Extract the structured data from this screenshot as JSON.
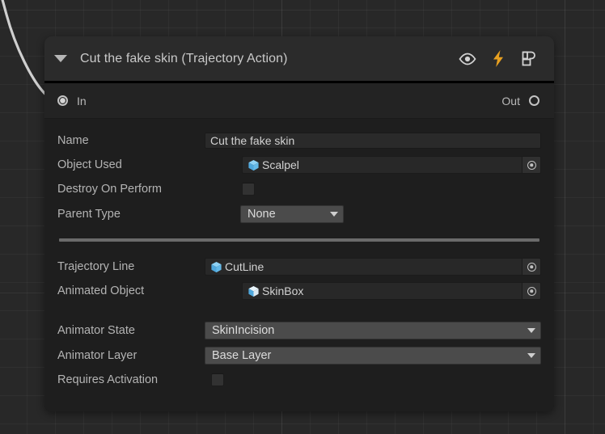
{
  "node": {
    "title": "Cut the fake skin (Trajectory Action)",
    "foldout_icon": "triangle-down-icon",
    "header_icons": [
      {
        "name": "eye-icon",
        "label": "Eye"
      },
      {
        "name": "lightning-bolt-icon",
        "label": "Lightning",
        "color": "#e8a020"
      },
      {
        "name": "preset-icon",
        "label": "Preset"
      }
    ],
    "ports": {
      "in_label": "In",
      "in_state": "connected",
      "out_label": "Out",
      "out_state": "disconnected"
    },
    "fields": {
      "name": {
        "label": "Name",
        "value": "Cut the fake skin",
        "placeholder": "Name"
      },
      "object_used": {
        "label": "Object Used",
        "value": "Scalpel",
        "icon": "prefab-cube-icon",
        "picker": "object-picker-icon"
      },
      "destroy_on_perform": {
        "label": "Destroy On Perform",
        "checked": false
      },
      "parent_type": {
        "label": "Parent Type",
        "value": "None"
      },
      "trajectory_line": {
        "label": "Trajectory Line",
        "value": "CutLine",
        "icon": "prefab-cube-icon",
        "picker": "object-picker-icon"
      },
      "animated_object": {
        "label": "Animated Object",
        "value": "SkinBox",
        "icon": "prefab-variant-cube-icon",
        "picker": "object-picker-icon"
      },
      "animator_state": {
        "label": "Animator State",
        "value": "SkinIncision"
      },
      "animator_layer": {
        "label": "Animator Layer",
        "value": "Base Layer"
      },
      "requires_activation": {
        "label": "Requires Activation",
        "checked": false
      }
    }
  },
  "canvas": {
    "edge_name": "incoming-connection-edge"
  },
  "colors": {
    "accent_orange": "#e8a020",
    "prefab_blue": "#6ec2f0",
    "panel_bg": "#1e1e1e",
    "header_bg": "#2b2b2b",
    "canvas_bg": "#282828"
  }
}
